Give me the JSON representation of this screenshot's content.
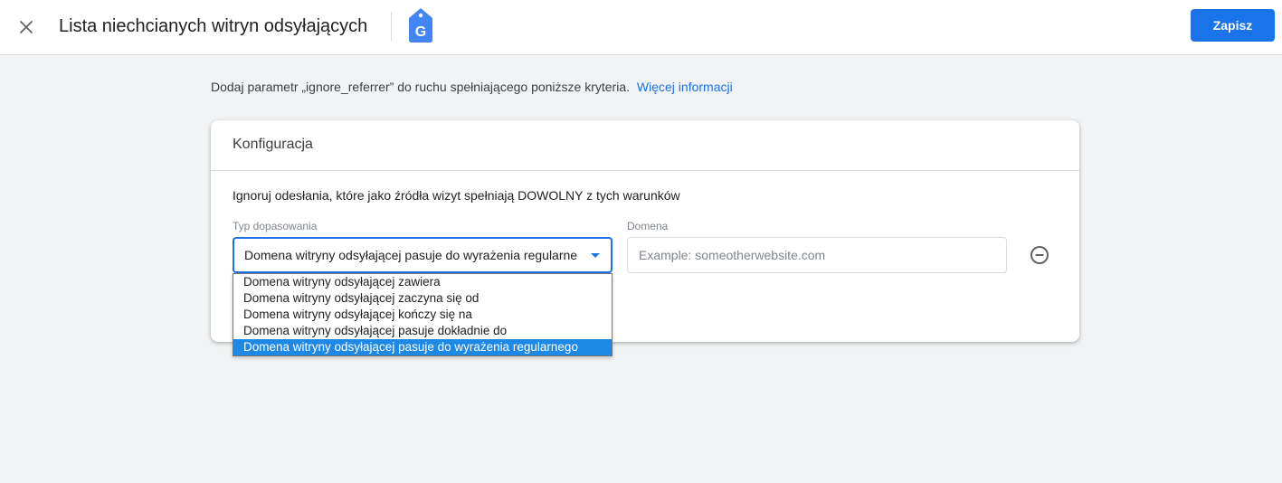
{
  "header": {
    "title": "Lista niechcianych witryn odsyłających",
    "save_label": "Zapisz",
    "logo_letter": "G"
  },
  "intro": {
    "text": "Dodaj parametr „ignore_referrer” do ruchu spełniającego poniższe kryteria.",
    "link_label": "Więcej informacji"
  },
  "card": {
    "title": "Konfiguracja",
    "condition_text": "Ignoruj odesłania, które jako źródła wizyt spełniają DOWOLNY z tych warunków",
    "match_type_label": "Typ dopasowania",
    "match_type_value": "Domena witryny odsyłającej pasuje do wyrażenia regularne",
    "domain_label": "Domena",
    "domain_placeholder": "Example: someotherwebsite.com",
    "domain_value": ""
  },
  "dropdown": {
    "options": [
      "Domena witryny odsyłającej zawiera",
      "Domena witryny odsyłającej zaczyna się od",
      "Domena witryny odsyłającej kończy się na",
      "Domena witryny odsyłającej pasuje dokładnie do",
      "Domena witryny odsyłającej pasuje do wyrażenia regularnego"
    ],
    "selected_index": 4
  },
  "colors": {
    "accent": "#1a73e8",
    "selected_option": "#1e88e5",
    "background": "#f1f3f4"
  },
  "icons": {
    "close": "close-icon",
    "logo": "tag-manager-logo-icon",
    "remove": "remove-circle-icon",
    "dropdown_arrow": "caret-down-icon"
  }
}
